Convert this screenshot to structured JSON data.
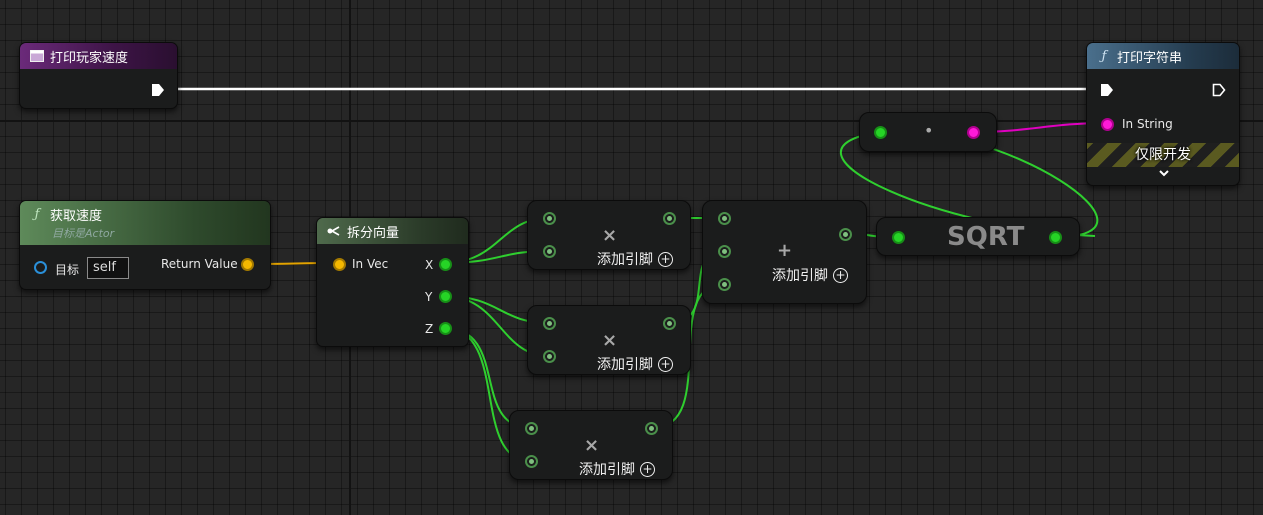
{
  "colors": {
    "float_wire": "#2fcf2f",
    "struct_wire": "#e3a300",
    "exec_wire": "#ffffff",
    "string_wire": "#e000c0"
  },
  "event_node": {
    "title": "打印玩家速度",
    "icon": "event-icon"
  },
  "get_velocity": {
    "title": "获取速度",
    "subtitle": "目标是Actor",
    "target_label": "目标",
    "target_value": "self",
    "return_label": "Return Value",
    "icon": "function-icon"
  },
  "break_vector": {
    "title": "拆分向量",
    "input_label": "In Vec",
    "outputs": [
      "X",
      "Y",
      "Z"
    ],
    "icon": "break-struct-icon"
  },
  "multiply_nodes": [
    {
      "op": "×",
      "add_pin": "添加引脚"
    },
    {
      "op": "×",
      "add_pin": "添加引脚"
    },
    {
      "op": "×",
      "add_pin": "添加引脚"
    }
  ],
  "add_node": {
    "op": "+",
    "add_pin": "添加引脚"
  },
  "sqrt_node": {
    "title": "SQRT"
  },
  "conversion_node": {
    "label": "•"
  },
  "print_string": {
    "title": "打印字符串",
    "in_string_label": "In String",
    "dev_only": "仅限开发",
    "icon": "function-icon",
    "expand_icon": "chevron-down-icon"
  }
}
